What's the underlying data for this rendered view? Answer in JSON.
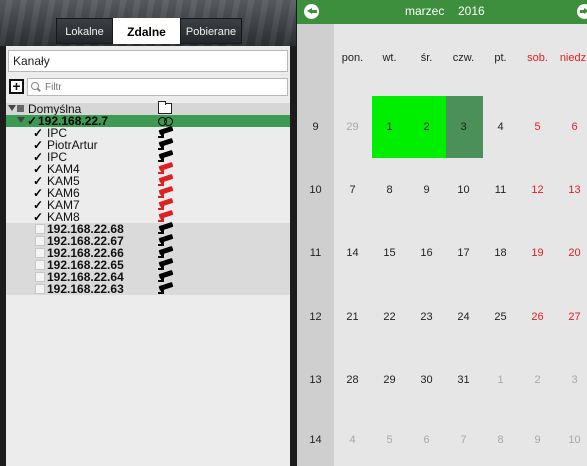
{
  "tabs": [
    {
      "label": "Lokalne"
    },
    {
      "label": "Zdalne",
      "active": true
    },
    {
      "label": "Pobierane"
    }
  ],
  "channels": {
    "title": "Kanały"
  },
  "filter": {
    "placeholder": "Filtr"
  },
  "tree": {
    "group": {
      "label": "Domyślna",
      "icon": "folder-icon"
    },
    "host": {
      "label": "192.168.22.7",
      "icon": "link-icon",
      "checked": true
    },
    "cameras": [
      {
        "label": "IPC",
        "checked": true,
        "status": "ok"
      },
      {
        "label": "PiotrArtur",
        "checked": true,
        "status": "ok"
      },
      {
        "label": "IPC",
        "checked": true,
        "status": "ok"
      },
      {
        "label": "KAM4",
        "checked": true,
        "status": "error"
      },
      {
        "label": "KAM5",
        "checked": true,
        "status": "error"
      },
      {
        "label": "KAM6",
        "checked": true,
        "status": "error"
      },
      {
        "label": "KAM7",
        "checked": true,
        "status": "error"
      },
      {
        "label": "KAM8",
        "checked": true,
        "status": "error"
      }
    ],
    "devices": [
      {
        "label": "192.168.22.68"
      },
      {
        "label": "192.168.22.67"
      },
      {
        "label": "192.168.22.66"
      },
      {
        "label": "192.168.22.65"
      },
      {
        "label": "192.168.22.64"
      },
      {
        "label": "192.168.22.63"
      }
    ]
  },
  "calendar": {
    "month": "marzec",
    "year": "2016",
    "weekdays": [
      "pon.",
      "wt.",
      "śr.",
      "czw.",
      "pt.",
      "sob.",
      "niedz."
    ],
    "weeks": [
      {
        "number": "9",
        "days": [
          "29",
          "1",
          "2",
          "3",
          "4",
          "5",
          "6"
        ]
      },
      {
        "number": "10",
        "days": [
          "7",
          "8",
          "9",
          "10",
          "11",
          "12",
          "13"
        ]
      },
      {
        "number": "11",
        "days": [
          "14",
          "15",
          "16",
          "17",
          "18",
          "19",
          "20"
        ]
      },
      {
        "number": "12",
        "days": [
          "21",
          "22",
          "23",
          "24",
          "25",
          "26",
          "27"
        ]
      },
      {
        "number": "13",
        "days": [
          "28",
          "29",
          "30",
          "31",
          "1",
          "2",
          "3"
        ]
      },
      {
        "number": "14",
        "days": [
          "4",
          "5",
          "6",
          "7",
          "8",
          "9",
          "10"
        ]
      }
    ],
    "highlighted_days": [
      "1",
      "2"
    ],
    "selected_day": "3",
    "colors": {
      "header": "#3d8f3d",
      "highlight": "#00ee00",
      "selected": "#4b8f59",
      "weekend": "#e02020",
      "tree_selected": "#3c9a53",
      "camera_ok": "#000000",
      "camera_error": "#e02020"
    }
  }
}
